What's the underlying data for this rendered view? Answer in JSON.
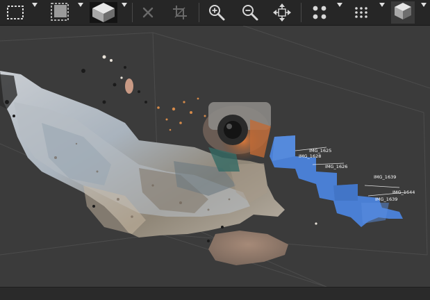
{
  "toolbar": {
    "items": [
      {
        "name": "marquee-select-icon"
      },
      {
        "name": "selection-fill-icon"
      },
      {
        "name": "navigation-cube-icon"
      },
      {
        "name": "delete-icon"
      },
      {
        "name": "crop-icon"
      },
      {
        "name": "zoom-in-icon"
      },
      {
        "name": "zoom-out-icon"
      },
      {
        "name": "fit-view-icon"
      },
      {
        "name": "point-size-large-icon"
      },
      {
        "name": "point-size-small-icon"
      },
      {
        "name": "view-mode-icon"
      }
    ]
  },
  "viewport": {
    "camera_labels": [
      "IMG_1625",
      "IMG_1628",
      "IMG_1626",
      "IMG_1639",
      "IMG_1644",
      "IMG_1639"
    ]
  },
  "colors": {
    "toolbar_bg": "#262626",
    "viewport_bg": "#3b3b3b",
    "camera_plane": "#4a7fd4",
    "label": "#ffffff"
  }
}
